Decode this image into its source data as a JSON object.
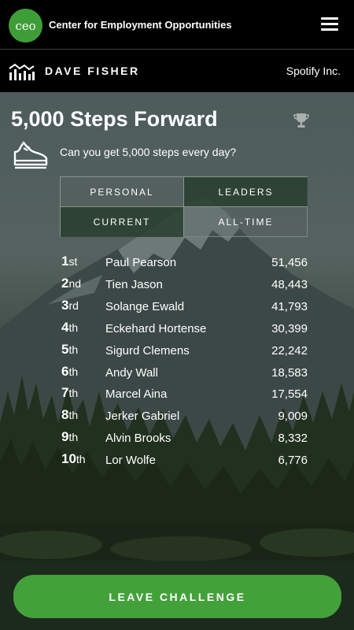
{
  "header": {
    "logo_text": "ceo",
    "org_name": "Center for Employment Opportunities",
    "menu_icon": "hamburger-menu-icon"
  },
  "user": {
    "name": "DAVE FISHER",
    "company": "Spotify Inc.",
    "icon": "bar-chart-icon"
  },
  "challenge": {
    "title": "5,000 Steps Forward",
    "subtitle": "Can you get 5,000 steps every day?",
    "trophy_icon": "trophy-icon",
    "shoe_icon": "sneaker-icon"
  },
  "tabs": {
    "personal": "PERSONAL",
    "leaders": "LEADERS",
    "current": "CURRENT",
    "all_time": "ALL-TIME",
    "selected": [
      "LEADERS",
      "CURRENT"
    ]
  },
  "leaderboard": [
    {
      "rank": "1",
      "suffix": "st",
      "name": "Paul Pearson",
      "score": "51,456"
    },
    {
      "rank": "2",
      "suffix": "nd",
      "name": "Tien Jason",
      "score": "48,443"
    },
    {
      "rank": "3",
      "suffix": "rd",
      "name": "Solange Ewald",
      "score": "41,793"
    },
    {
      "rank": "4",
      "suffix": "th",
      "name": "Eckehard Hortense",
      "score": "30,399"
    },
    {
      "rank": "5",
      "suffix": "th",
      "name": "Sigurd Clemens",
      "score": "22,242"
    },
    {
      "rank": "6",
      "suffix": "th",
      "name": "Andy Wall",
      "score": "18,583"
    },
    {
      "rank": "7",
      "suffix": "th",
      "name": "Marcel Aina",
      "score": "17,554"
    },
    {
      "rank": "8",
      "suffix": "th",
      "name": "Jerker Gabriel",
      "score": "9,009"
    },
    {
      "rank": "9",
      "suffix": "th",
      "name": "Alvin Brooks",
      "score": "8,332"
    },
    {
      "rank": "10",
      "suffix": "th",
      "name": "Lor Wolfe",
      "score": "6,776"
    }
  ],
  "footer": {
    "leave_label": "LEAVE CHALLENGE"
  },
  "colors": {
    "brand_green": "#43a13a",
    "bar_black": "#000000"
  }
}
